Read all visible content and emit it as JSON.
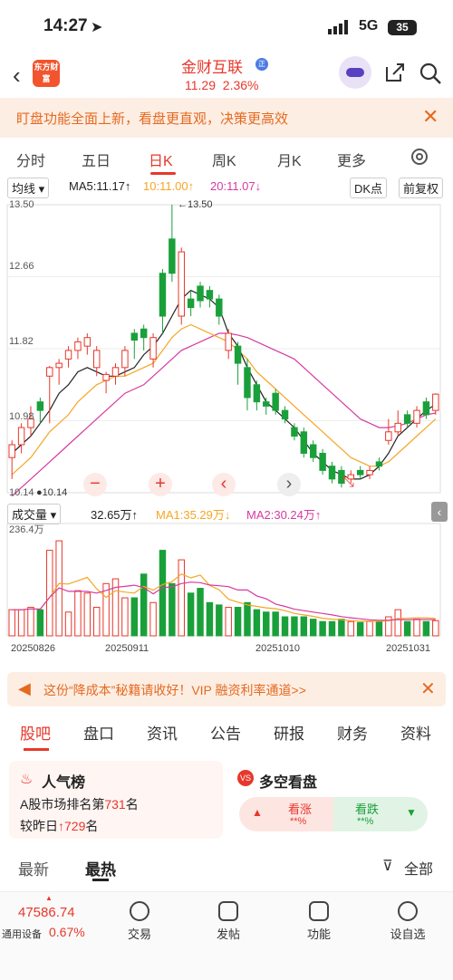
{
  "status": {
    "time": "14:27",
    "network": "5G",
    "battery": "35"
  },
  "header": {
    "stock_name": "金财互联",
    "badge": "正",
    "price": "11.29",
    "change": "2.36%",
    "logo_text": "东方财富"
  },
  "banner": {
    "text": "盯盘功能全面上新，看盘更直观，决策更高效",
    "close": "✕"
  },
  "tabs": [
    {
      "label": "分时"
    },
    {
      "label": "五日"
    },
    {
      "label": "日K"
    },
    {
      "label": "周K"
    },
    {
      "label": "月K"
    },
    {
      "label": "更多"
    }
  ],
  "indicator": {
    "select": "均线",
    "ma5": "MA5:11.17↑",
    "ma10": "10:11.00↑",
    "ma20": "20:11.07↓",
    "dk": "DK点",
    "fq": "前复权"
  },
  "colors": {
    "up": "#e8372b",
    "down": "#1aa03a",
    "ma5": "#222222",
    "ma10": "#f5a623",
    "ma20": "#d63aa0",
    "accent": "#e8372b"
  },
  "price_axis": {
    "labels": [
      "13.50",
      "12.66",
      "11.82",
      "10.98",
      "10.14"
    ],
    "high_label": "13.50",
    "low_label": "10.14"
  },
  "volume": {
    "select": "成交量",
    "vol": "32.65万↑",
    "ma1": "MA1:35.29万↓",
    "ma2": "MA2:30.24万↑",
    "max_label": "236.4万"
  },
  "dates": [
    "20250826",
    "20250911",
    "20251010",
    "20251031"
  ],
  "chart_data": {
    "type": "candlestick",
    "ylim": [
      10.14,
      13.5
    ],
    "volume_max": 236.4,
    "candles": [
      [
        10.55,
        10.7,
        10.3,
        10.75
      ],
      [
        10.7,
        10.9,
        10.6,
        10.95
      ],
      [
        10.9,
        11.0,
        10.8,
        11.15
      ],
      [
        11.2,
        11.1,
        10.95,
        11.25
      ],
      [
        11.5,
        11.6,
        10.95,
        11.62
      ],
      [
        11.6,
        11.65,
        11.4,
        11.7
      ],
      [
        11.7,
        11.8,
        11.6,
        11.85
      ],
      [
        11.8,
        11.9,
        11.7,
        11.95
      ],
      [
        11.85,
        11.95,
        11.75,
        12.0
      ],
      [
        11.6,
        11.8,
        11.5,
        11.85
      ],
      [
        11.45,
        11.52,
        11.3,
        11.55
      ],
      [
        11.5,
        11.6,
        11.4,
        11.65
      ],
      [
        11.6,
        11.8,
        11.5,
        11.85
      ],
      [
        12.0,
        11.92,
        11.7,
        12.05
      ],
      [
        12.05,
        11.95,
        11.8,
        12.1
      ],
      [
        11.7,
        11.95,
        11.6,
        12.0
      ],
      [
        12.7,
        12.2,
        12.0,
        12.75
      ],
      [
        13.1,
        12.7,
        12.6,
        13.5
      ],
      [
        12.2,
        12.95,
        12.1,
        13.0
      ],
      [
        12.4,
        12.3,
        12.2,
        12.5
      ],
      [
        12.55,
        12.38,
        12.3,
        12.6
      ],
      [
        12.5,
        12.4,
        12.3,
        12.55
      ],
      [
        12.4,
        12.2,
        12.1,
        12.45
      ],
      [
        11.8,
        12.0,
        11.7,
        12.05
      ],
      [
        11.85,
        11.65,
        11.4,
        11.9
      ],
      [
        11.6,
        11.25,
        11.1,
        11.7
      ],
      [
        11.4,
        11.2,
        11.1,
        11.45
      ],
      [
        11.2,
        11.15,
        11.05,
        11.25
      ],
      [
        11.3,
        11.1,
        11.05,
        11.35
      ],
      [
        11.1,
        11.0,
        10.95,
        11.15
      ],
      [
        10.9,
        10.8,
        10.75,
        10.95
      ],
      [
        10.85,
        10.6,
        10.55,
        10.9
      ],
      [
        10.7,
        10.55,
        10.5,
        10.75
      ],
      [
        10.6,
        10.4,
        10.35,
        10.65
      ],
      [
        10.45,
        10.3,
        10.25,
        10.5
      ],
      [
        10.4,
        10.25,
        10.2,
        10.45
      ],
      [
        10.3,
        10.35,
        10.25,
        10.4
      ],
      [
        10.4,
        10.35,
        10.3,
        10.45
      ],
      [
        10.35,
        10.4,
        10.3,
        10.45
      ],
      [
        10.5,
        10.45,
        10.4,
        10.55
      ],
      [
        10.75,
        10.85,
        10.7,
        11.0
      ],
      [
        10.85,
        10.95,
        10.8,
        11.1
      ],
      [
        11.05,
        10.95,
        10.9,
        11.1
      ],
      [
        10.95,
        11.1,
        10.9,
        11.15
      ],
      [
        11.2,
        11.05,
        11.0,
        11.25
      ],
      [
        11.1,
        11.29,
        11.05,
        11.3
      ]
    ],
    "volumes": [
      55,
      55,
      60,
      55,
      180,
      200,
      50,
      95,
      90,
      60,
      110,
      120,
      80,
      80,
      130,
      70,
      180,
      110,
      160,
      90,
      100,
      70,
      65,
      60,
      60,
      70,
      55,
      50,
      50,
      40,
      40,
      40,
      35,
      30,
      30,
      35,
      30,
      28,
      30,
      30,
      40,
      55,
      30,
      35,
      30,
      32
    ],
    "ma5": [
      10.6,
      10.7,
      10.8,
      10.95,
      11.1,
      11.3,
      11.4,
      11.55,
      11.6,
      11.55,
      11.5,
      11.5,
      11.55,
      11.6,
      11.75,
      11.85,
      12.0,
      12.2,
      12.4,
      12.5,
      12.45,
      12.4,
      12.3,
      12.0,
      11.85,
      11.6,
      11.4,
      11.2,
      11.1,
      11.0,
      10.9,
      10.75,
      10.6,
      10.5,
      10.4,
      10.35,
      10.3,
      10.3,
      10.35,
      10.45,
      10.6,
      10.8,
      10.9,
      11.0,
      11.1,
      11.17
    ],
    "ma10": [
      10.35,
      10.45,
      10.55,
      10.7,
      10.85,
      10.95,
      11.05,
      11.2,
      11.3,
      11.4,
      11.45,
      11.5,
      11.5,
      11.55,
      11.6,
      11.65,
      11.8,
      11.95,
      12.05,
      12.1,
      12.05,
      12.0,
      11.95,
      11.9,
      11.8,
      11.7,
      11.55,
      11.45,
      11.35,
      11.25,
      11.15,
      11.05,
      10.95,
      10.85,
      10.75,
      10.65,
      10.55,
      10.5,
      10.45,
      10.45,
      10.5,
      10.6,
      10.7,
      10.8,
      10.9,
      11.0
    ],
    "ma20": [
      10.1,
      10.2,
      10.3,
      10.4,
      10.5,
      10.6,
      10.7,
      10.8,
      10.9,
      11.0,
      11.1,
      11.2,
      11.3,
      11.35,
      11.4,
      11.5,
      11.6,
      11.7,
      11.8,
      11.85,
      11.9,
      11.95,
      12.0,
      12.0,
      11.98,
      11.95,
      11.9,
      11.85,
      11.8,
      11.75,
      11.7,
      11.6,
      11.5,
      11.4,
      11.3,
      11.2,
      11.1,
      11.0,
      10.95,
      10.9,
      10.9,
      10.92,
      10.95,
      11.0,
      11.05,
      11.07
    ]
  },
  "chart_controls": {
    "minus": "−",
    "plus": "+",
    "left": "‹",
    "right": "›"
  },
  "ad": {
    "text": "这份“降成本”秘籍请收好！VIP 融资利率通道>>",
    "close": "✕"
  },
  "subtabs": [
    {
      "label": "股吧"
    },
    {
      "label": "盘口"
    },
    {
      "label": "资讯"
    },
    {
      "label": "公告"
    },
    {
      "label": "研报"
    },
    {
      "label": "财务"
    },
    {
      "label": "资料"
    }
  ],
  "popularity": {
    "title": "人气榜",
    "rank_prefix": "A股市场排名第",
    "rank": "731",
    "rank_suffix": "名",
    "change_prefix": "较昨日",
    "change": "729",
    "change_suffix": "名"
  },
  "sentiment": {
    "title": "多空看盘",
    "bull": "看涨",
    "bull_pct": "**%",
    "bear": "看跌",
    "bear_pct": "**%"
  },
  "feed": {
    "latest": "最新",
    "hot": "最热",
    "filter": "全部"
  },
  "bottom": {
    "index_value": "47586.74",
    "index_name": "通用设备",
    "index_change": "0.67%",
    "items": [
      {
        "label": "交易"
      },
      {
        "label": "发帖"
      },
      {
        "label": "功能"
      },
      {
        "label": "设自选"
      }
    ]
  }
}
